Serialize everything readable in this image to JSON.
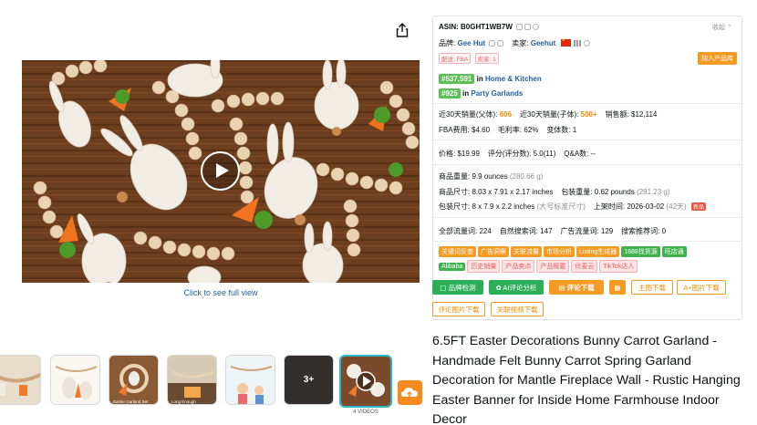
{
  "media": {
    "video_link": "Click to see full view",
    "thumb_more": "3+",
    "thumb_caption": "4 VIDEOS",
    "thumb_texts": [
      "Easter Garland Set",
      "Long Enough"
    ]
  },
  "panel": {
    "collapse": "收起 ⌃",
    "asin_label": "ASIN:",
    "asin": "B0GHT1WB7W",
    "brand_label": "品牌:",
    "brand": "Gee Hut",
    "seller_label": "卖家:",
    "seller": "Geehut",
    "shipping_tags": [
      "配送: FBA",
      "卖家: 1"
    ],
    "add_product": "加入产品库",
    "rank1": "#537,591",
    "rank1_in": "in",
    "rank1_cat": "Home & Kitchen",
    "rank2": "#925",
    "rank2_in": "in",
    "rank2_cat": "Party Garlands",
    "sales_parent_label": "近30天销量(父体):",
    "sales_parent": "606",
    "sales_child_label": "近30天销量(子体):",
    "sales_child": "500+",
    "revenue_label": "销售额:",
    "revenue": "$12,114",
    "fba_label": "FBA费用:",
    "fba": "$4.60",
    "margin_label": "毛利率:",
    "margin": "62%",
    "variants_label": "变体数:",
    "variants": "1",
    "price_label": "价格:",
    "price": "$19.99",
    "rating_label": "评分(评分数):",
    "rating": "5.0(11)",
    "qa_label": "Q&A数:",
    "qa": "--",
    "weight_label": "商品重量:",
    "weight": "9.9 ounces",
    "weight_g": "(280.66 g)",
    "size_label": "商品尺寸:",
    "size": "8.03 x 7.91 x 2.17 inches",
    "pkg_weight_label": "包装重量:",
    "pkg_weight": "0.62 pounds",
    "pkg_weight_g": "(281.23 g)",
    "pkg_size_label": "包装尺寸:",
    "pkg_size": "8 x 7.9 x 2.2 inches",
    "pkg_size_note": "(大号标准尺寸)",
    "listed_label": "上架时间:",
    "listed": "2026-03-02",
    "listed_days": "(42天)",
    "new_badge": "新品",
    "traffic_all_label": "全部流量词:",
    "traffic_all": "224",
    "traffic_natural_label": "自然搜索词:",
    "traffic_natural": "147",
    "traffic_ad_label": "广告流量词:",
    "traffic_ad": "129",
    "traffic_rec_label": "搜索推荐词:",
    "traffic_rec": "0",
    "tool_tags_row1": [
      "关键词反查",
      "广告洞察",
      "关联流量",
      "市场分析",
      "Listing生成器",
      "1688找货源",
      "旺店通"
    ],
    "tool_tags_row2": [
      "Alibaba",
      "历史销量",
      "产品卖点",
      "产品概要",
      "优麦云",
      "TikTok达人"
    ],
    "buttons_row1": [
      "▢ 品牌检测",
      "✿ AI评论分析",
      "▤ 评论下载",
      "▦",
      "主图下载",
      "A+图片下载"
    ],
    "buttons_row2": [
      "评论图片下载",
      "关联视频下载"
    ]
  },
  "product_title": "6.5FT Easter Decorations Bunny Carrot Garland - Handmade Felt Bunny Carrot Spring Garland Decoration for Mantle Fireplace Wall - Rustic Hanging Easter Banner for Inside Home Farmhouse Indoor Decor"
}
